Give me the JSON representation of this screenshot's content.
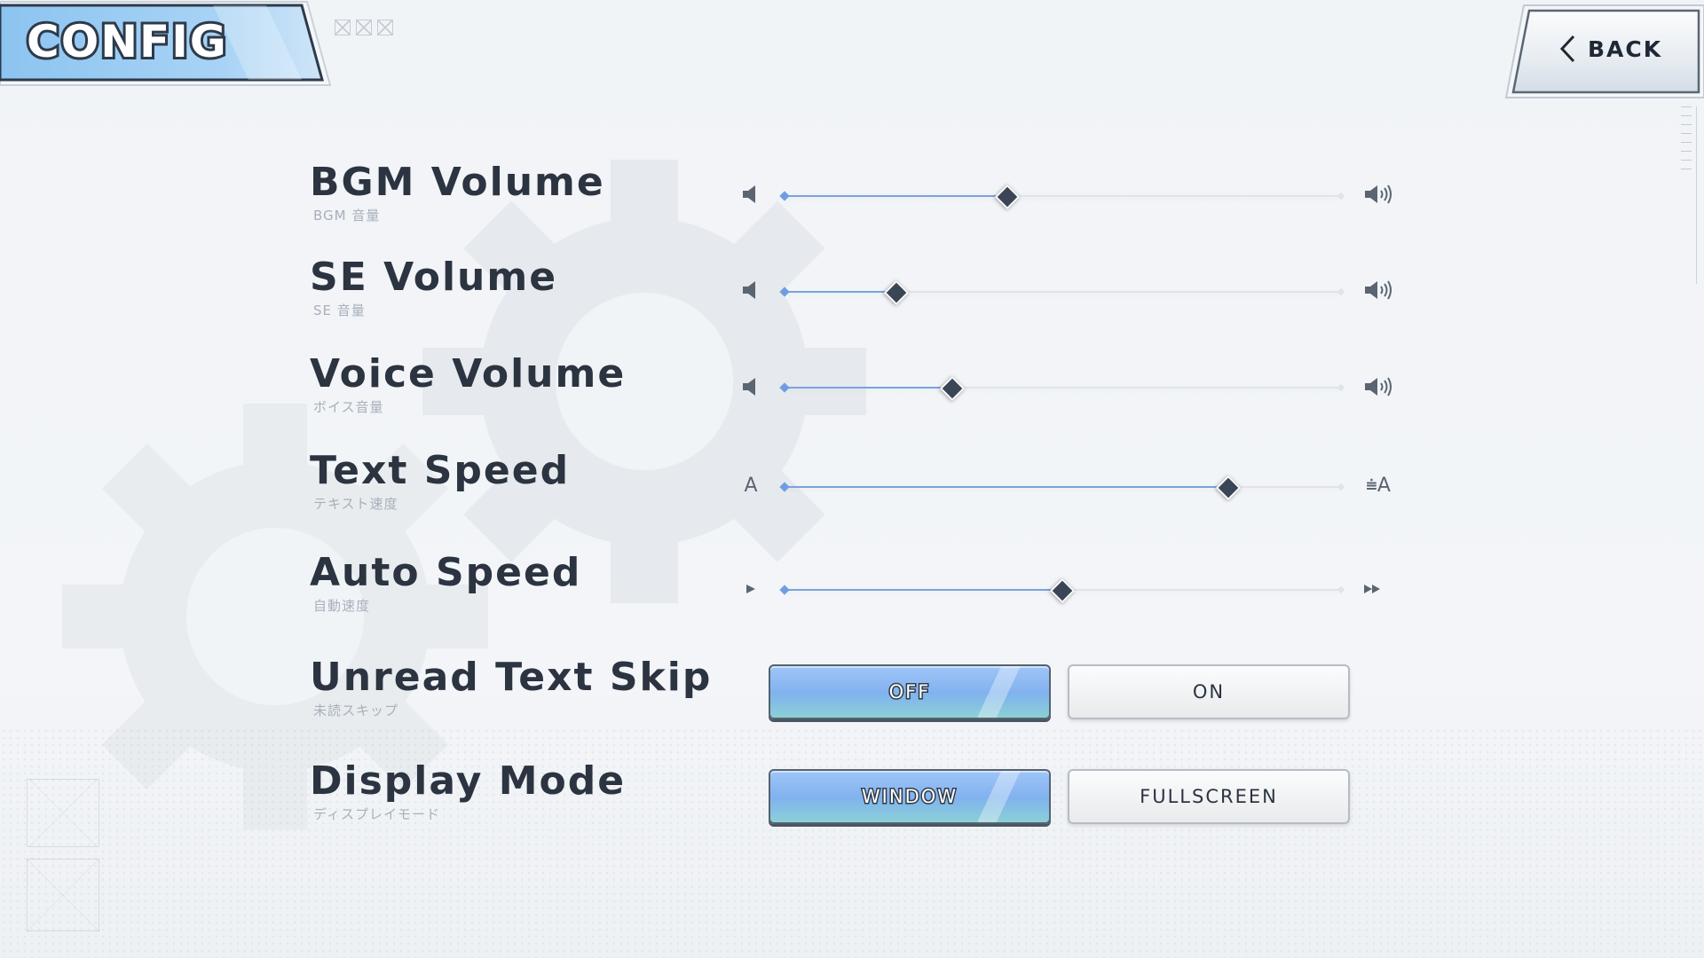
{
  "header": {
    "title": "CONFIG",
    "back_label": "BACK"
  },
  "settings": [
    {
      "label": "BGM Volume",
      "sublabel": "BGM 音量",
      "type": "slider",
      "value": 0.4,
      "min_icon": "speaker-mute-icon",
      "max_icon": "speaker-loud-icon"
    },
    {
      "label": "SE Volume",
      "sublabel": "SE 音量",
      "type": "slider",
      "value": 0.2,
      "min_icon": "speaker-mute-icon",
      "max_icon": "speaker-loud-icon"
    },
    {
      "label": "Voice Volume",
      "sublabel": "ボイス音量",
      "type": "slider",
      "value": 0.3,
      "min_icon": "speaker-mute-icon",
      "max_icon": "speaker-loud-icon"
    },
    {
      "label": "Text Speed",
      "sublabel": "テキスト速度",
      "type": "slider",
      "value": 0.8,
      "min_icon_text": "A",
      "max_icon_text": "⩧A"
    },
    {
      "label": "Auto Speed",
      "sublabel": "自動速度",
      "type": "slider",
      "value": 0.5,
      "min_icon": "play-icon",
      "max_icon": "fast-forward-icon"
    },
    {
      "label": "Unread Text Skip",
      "sublabel": "未読スキップ",
      "type": "toggle",
      "options": [
        "OFF",
        "ON"
      ],
      "selected": "OFF"
    },
    {
      "label": "Display Mode",
      "sublabel": "ディスプレイモード",
      "type": "toggle",
      "options": [
        "WINDOW",
        "FULLSCREEN"
      ],
      "selected": "WINDOW"
    }
  ],
  "colors": {
    "accent": "#7fb2ee",
    "handle": "#3a4656",
    "text": "#2b3440"
  }
}
